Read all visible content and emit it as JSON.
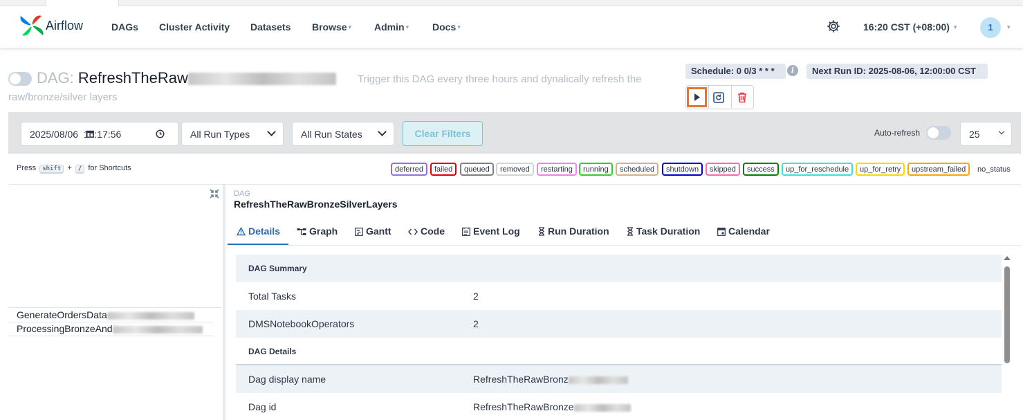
{
  "nav": {
    "brand": "Airflow",
    "items": [
      {
        "label": "DAGs",
        "caret": false
      },
      {
        "label": "Cluster Activity",
        "caret": false
      },
      {
        "label": "Datasets",
        "caret": false
      },
      {
        "label": "Browse",
        "caret": true
      },
      {
        "label": "Admin",
        "caret": true
      },
      {
        "label": "Docs",
        "caret": true
      }
    ],
    "time": "16:20 CST (+08:00)",
    "user_initial": "1"
  },
  "header": {
    "dag_label": "DAG:",
    "dag_title_visible": "RefreshTheRaw",
    "description_line1": "Trigger this DAG every three hours and dynalically refresh the",
    "description_line2": "raw/bronze/silver layers",
    "schedule": "Schedule: 0 0/3 * * *",
    "next_run": "Next Run ID: 2025-08-06, 12:00:00 CST"
  },
  "filters": {
    "datetime": "2025/08/06  16:17:56",
    "run_types": "All Run Types",
    "run_states": "All Run States",
    "clear_label": "Clear Filters",
    "autorefresh_label": "Auto-refresh",
    "page_size": "25"
  },
  "shortcuts": {
    "press": "Press",
    "key1": "shift",
    "plus": "+",
    "key2": "/",
    "suffix": "for Shortcuts"
  },
  "states": [
    {
      "label": "deferred",
      "color": "#9370db"
    },
    {
      "label": "failed",
      "color": "#e00000"
    },
    {
      "label": "queued",
      "color": "#808080"
    },
    {
      "label": "removed",
      "color": "#d3d3d3"
    },
    {
      "label": "restarting",
      "color": "#ee82ee"
    },
    {
      "label": "running",
      "color": "#32cd32"
    },
    {
      "label": "scheduled",
      "color": "#d2b48c"
    },
    {
      "label": "shutdown",
      "color": "#0000cd"
    },
    {
      "label": "skipped",
      "color": "#ff69b4"
    },
    {
      "label": "success",
      "color": "#008000"
    },
    {
      "label": "up_for_reschedule",
      "color": "#40e0d0"
    },
    {
      "label": "up_for_retry",
      "color": "#ffd700"
    },
    {
      "label": "upstream_failed",
      "color": "#ffa500"
    },
    {
      "label": "no_status",
      "color": "transparent"
    }
  ],
  "tasks": [
    {
      "visible": "GenerateOrdersData"
    },
    {
      "visible": "ProcessingBronzeAnd"
    }
  ],
  "dag_panel": {
    "small_label": "DAG",
    "name": "RefreshTheRawBronzeSilverLayers"
  },
  "tabs": [
    {
      "label": "Details",
      "icon": "warning-triangle-icon"
    },
    {
      "label": "Graph",
      "icon": "graph-icon"
    },
    {
      "label": "Gantt",
      "icon": "gantt-icon"
    },
    {
      "label": "Code",
      "icon": "code-icon"
    },
    {
      "label": "Event Log",
      "icon": "event-log-icon"
    },
    {
      "label": "Run Duration",
      "icon": "hourglass-icon"
    },
    {
      "label": "Task Duration",
      "icon": "hourglass-icon"
    },
    {
      "label": "Calendar",
      "icon": "calendar-icon"
    }
  ],
  "details": {
    "summary_heading": "DAG Summary",
    "total_tasks_key": "Total Tasks",
    "total_tasks_value": "2",
    "operator_key": "DMSNotebookOperators",
    "operator_value": "2",
    "details_heading": "DAG Details",
    "display_name_key": "Dag display name",
    "display_name_visible": "RefreshTheRawBronz",
    "dag_id_key": "Dag id",
    "dag_id_visible": "RefreshTheRawBronze"
  }
}
